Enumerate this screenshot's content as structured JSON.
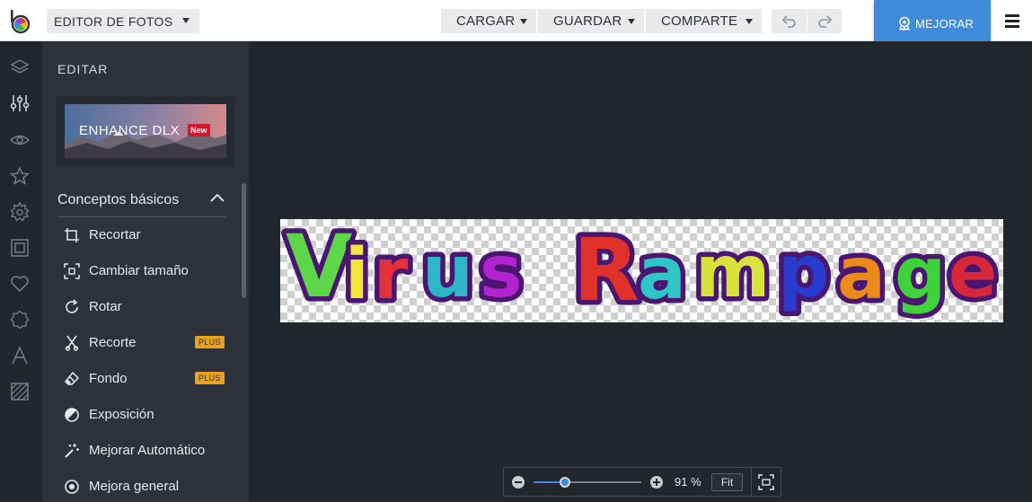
{
  "header": {
    "editor_menu_label": "EDITOR DE FOTOS",
    "menus": [
      {
        "label": "CARGAR"
      },
      {
        "label": "GUARDAR"
      },
      {
        "label": "COMPARTE"
      }
    ],
    "upgrade_label": "MEJORAR"
  },
  "panel": {
    "title": "EDITAR",
    "promo": {
      "title": "ENHANCE DLX",
      "badge": "New"
    },
    "section_title": "Conceptos básicos",
    "tools": [
      {
        "label": "Recortar",
        "icon": "crop-icon"
      },
      {
        "label": "Cambiar tamaño",
        "icon": "resize-icon"
      },
      {
        "label": "Rotar",
        "icon": "rotate-icon"
      },
      {
        "label": "Recorte",
        "icon": "cutout-icon",
        "badge": "PLUS"
      },
      {
        "label": "Fondo",
        "icon": "eraser-icon",
        "badge": "PLUS"
      },
      {
        "label": "Exposición",
        "icon": "exposure-icon"
      },
      {
        "label": "Mejorar Automático",
        "icon": "magic-wand-icon"
      },
      {
        "label": "Mejora general",
        "icon": "target-icon"
      }
    ]
  },
  "rail": [
    "layers-icon",
    "adjustments-icon",
    "eye-icon",
    "star-icon",
    "gear-icon",
    "frame-icon",
    "heart-icon",
    "badge-icon",
    "text-icon",
    "texture-icon"
  ],
  "canvas": {
    "image_text": "Virus Rampage"
  },
  "zoom": {
    "value_label": "91 %",
    "level": 0.29,
    "fit_label": "Fit"
  },
  "colors": {
    "accent": "#3f8cdc",
    "panel": "#2e333b",
    "canvas": "#22262d",
    "plus_badge": "#e8a220",
    "new_badge": "#d8162a"
  }
}
